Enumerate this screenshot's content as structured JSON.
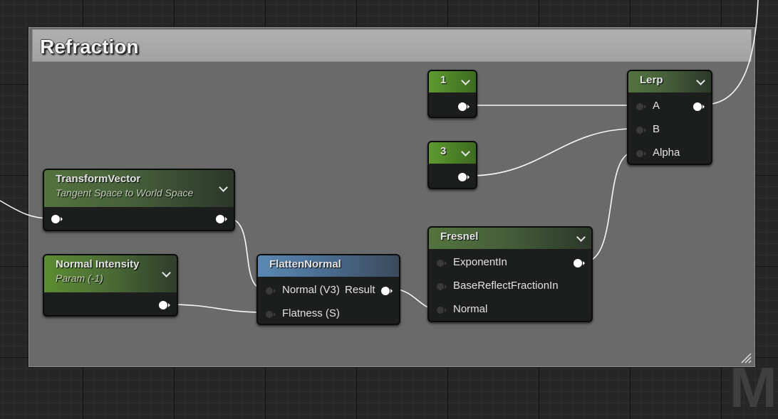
{
  "comment": {
    "title": "Refraction"
  },
  "nodes": {
    "const1": {
      "title": "1"
    },
    "const3": {
      "title": "3"
    },
    "lerp": {
      "title": "Lerp",
      "inputs": [
        "A",
        "B",
        "Alpha"
      ]
    },
    "transform_vector": {
      "title": "TransformVector",
      "subtitle": "Tangent Space to World Space"
    },
    "normal_intensity": {
      "title": "Normal Intensity",
      "subtitle": "Param (-1)"
    },
    "flatten_normal": {
      "title": "FlattenNormal",
      "inputs": [
        "Normal (V3)",
        "Flatness (S)"
      ],
      "output": "Result"
    },
    "fresnel": {
      "title": "Fresnel",
      "inputs": [
        "ExponentIn",
        "BaseReflectFractionIn",
        "Normal"
      ]
    }
  },
  "watermark": "M",
  "colors": {
    "graph_bg": "#262626",
    "comment_body": "#6a6a6a",
    "comment_header": "#aaaaaa",
    "wire": "#ffffff",
    "material_header_green": "#5b8c30",
    "function_header_blue": "#5a88b3"
  }
}
